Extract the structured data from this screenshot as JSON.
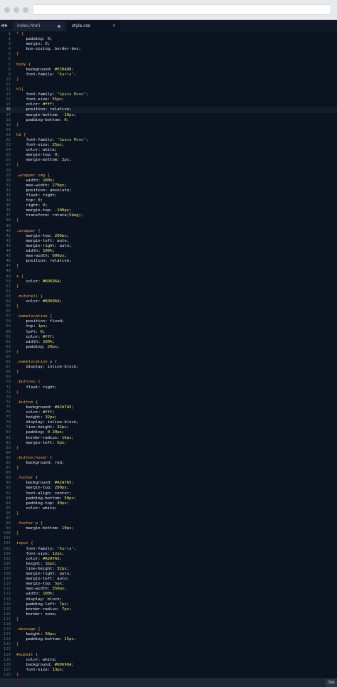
{
  "tabs": [
    {
      "label": "index.html",
      "active": false
    },
    {
      "label": "style.css",
      "active": true
    }
  ],
  "active_line": 16,
  "status": {
    "right_label": "Tab"
  },
  "code_lines": [
    [
      [
        "sel",
        "* {"
      ]
    ],
    [
      [
        "prop",
        "    padding"
      ],
      [
        "kw",
        ": "
      ],
      [
        "val",
        "0"
      ],
      [
        "kw",
        ";"
      ]
    ],
    [
      [
        "prop",
        "    margin"
      ],
      [
        "kw",
        ": "
      ],
      [
        "val",
        "0"
      ],
      [
        "kw",
        ";"
      ]
    ],
    [
      [
        "prop",
        "    box-sizing"
      ],
      [
        "kw",
        ": border-box;"
      ]
    ],
    [
      [
        "sel",
        "}"
      ]
    ],
    [
      [
        "kw",
        ""
      ]
    ],
    [
      [
        "sel",
        "body {"
      ]
    ],
    [
      [
        "prop",
        "    background"
      ],
      [
        "kw",
        ": "
      ],
      [
        "val",
        "#E2DAD8"
      ],
      [
        "kw",
        ";"
      ]
    ],
    [
      [
        "prop",
        "    font-family"
      ],
      [
        "kw",
        ": "
      ],
      [
        "str",
        "\"Karla\""
      ],
      [
        "kw",
        ";"
      ]
    ],
    [
      [
        "sel",
        "}"
      ]
    ],
    [
      [
        "kw",
        ""
      ]
    ],
    [
      [
        "sel",
        "h1{"
      ]
    ],
    [
      [
        "prop",
        "    font-family"
      ],
      [
        "kw",
        ": "
      ],
      [
        "str",
        "\"Space Mono\""
      ],
      [
        "kw",
        ";"
      ]
    ],
    [
      [
        "prop",
        "    font-size"
      ],
      [
        "kw",
        ": "
      ],
      [
        "val",
        "55px"
      ],
      [
        "kw",
        ";"
      ]
    ],
    [
      [
        "prop",
        "    color"
      ],
      [
        "kw",
        ": "
      ],
      [
        "val",
        "#fff"
      ],
      [
        "kw",
        ";"
      ]
    ],
    [
      [
        "prop",
        "    position"
      ],
      [
        "kw",
        ": relative;"
      ]
    ],
    [
      [
        "prop",
        "    margin-bottom"
      ],
      [
        "kw",
        ": "
      ],
      [
        "val",
        "-10px"
      ],
      [
        "kw",
        ";"
      ]
    ],
    [
      [
        "prop",
        "    padding-bottom"
      ],
      [
        "kw",
        ": "
      ],
      [
        "val",
        "0"
      ],
      [
        "kw",
        ";"
      ]
    ],
    [
      [
        "sel",
        "}"
      ]
    ],
    [
      [
        "kw",
        ""
      ]
    ],
    [
      [
        "sel",
        "h2 {"
      ]
    ],
    [
      [
        "prop",
        "    font-family"
      ],
      [
        "kw",
        ": "
      ],
      [
        "str",
        "\"Space Mono\""
      ],
      [
        "kw",
        ";"
      ]
    ],
    [
      [
        "prop",
        "    font-size"
      ],
      [
        "kw",
        ": "
      ],
      [
        "val",
        "25px"
      ],
      [
        "kw",
        ";"
      ]
    ],
    [
      [
        "prop",
        "    color"
      ],
      [
        "kw",
        ": white;"
      ]
    ],
    [
      [
        "prop",
        "    margin-top"
      ],
      [
        "kw",
        ": "
      ],
      [
        "val",
        "0"
      ],
      [
        "kw",
        ";"
      ]
    ],
    [
      [
        "prop",
        "    margin-bottom"
      ],
      [
        "kw",
        ": "
      ],
      [
        "val",
        "2px"
      ],
      [
        "kw",
        ";"
      ]
    ],
    [
      [
        "sel",
        "}"
      ]
    ],
    [
      [
        "kw",
        ""
      ]
    ],
    [
      [
        "sel",
        ".wrapper img {"
      ]
    ],
    [
      [
        "prop",
        "    width"
      ],
      [
        "kw",
        ": "
      ],
      [
        "val",
        "100%"
      ],
      [
        "kw",
        ";"
      ]
    ],
    [
      [
        "prop",
        "    max-width"
      ],
      [
        "kw",
        ": "
      ],
      [
        "val",
        "270px"
      ],
      [
        "kw",
        ";"
      ]
    ],
    [
      [
        "prop",
        "    position"
      ],
      [
        "kw",
        ": absolute;"
      ]
    ],
    [
      [
        "prop",
        "    float"
      ],
      [
        "kw",
        ": right;"
      ]
    ],
    [
      [
        "prop",
        "    top"
      ],
      [
        "kw",
        ": "
      ],
      [
        "val",
        "0"
      ],
      [
        "kw",
        ";"
      ]
    ],
    [
      [
        "prop",
        "    right"
      ],
      [
        "kw",
        ": "
      ],
      [
        "val",
        "0"
      ],
      [
        "kw",
        ";"
      ]
    ],
    [
      [
        "prop",
        "    margin-top"
      ],
      [
        "kw",
        ": "
      ],
      [
        "val",
        "-100px"
      ],
      [
        "kw",
        ";"
      ]
    ],
    [
      [
        "prop",
        "    transform"
      ],
      [
        "kw",
        ": rotate("
      ],
      [
        "val",
        "5deg"
      ],
      [
        "kw",
        ");"
      ]
    ],
    [
      [
        "sel",
        "}"
      ]
    ],
    [
      [
        "kw",
        ""
      ]
    ],
    [
      [
        "sel",
        ".wrapper {"
      ]
    ],
    [
      [
        "prop",
        "    margin-top"
      ],
      [
        "kw",
        ": "
      ],
      [
        "val",
        "200px"
      ],
      [
        "kw",
        ";"
      ]
    ],
    [
      [
        "prop",
        "    margin-left"
      ],
      [
        "kw",
        ": auto;"
      ]
    ],
    [
      [
        "prop",
        "    margin-right"
      ],
      [
        "kw",
        ": auto;"
      ]
    ],
    [
      [
        "prop",
        "    width"
      ],
      [
        "kw",
        ": "
      ],
      [
        "val",
        "100%"
      ],
      [
        "kw",
        ";"
      ]
    ],
    [
      [
        "prop",
        "    max-width"
      ],
      [
        "kw",
        ": "
      ],
      [
        "val",
        "600px"
      ],
      [
        "kw",
        ";"
      ]
    ],
    [
      [
        "prop",
        "    position"
      ],
      [
        "kw",
        ": relative;"
      ]
    ],
    [
      [
        "sel",
        "}"
      ]
    ],
    [
      [
        "kw",
        ""
      ]
    ],
    [
      [
        "sel",
        "a {"
      ]
    ],
    [
      [
        "prop",
        "    color"
      ],
      [
        "kw",
        ": "
      ],
      [
        "val",
        "#6D696A"
      ],
      [
        "kw",
        ";"
      ]
    ],
    [
      [
        "sel",
        "}"
      ]
    ],
    [
      [
        "kw",
        ""
      ]
    ],
    [
      [
        "sel",
        ".nutshell {"
      ]
    ],
    [
      [
        "prop",
        "    color"
      ],
      [
        "kw",
        ": "
      ],
      [
        "val",
        "#6D696A"
      ],
      [
        "kw",
        ";"
      ]
    ],
    [
      [
        "sel",
        "}"
      ]
    ],
    [
      [
        "kw",
        ""
      ]
    ],
    [
      [
        "sel",
        ".namelocation {"
      ]
    ],
    [
      [
        "prop",
        "    position"
      ],
      [
        "kw",
        ": fixed;"
      ]
    ],
    [
      [
        "prop",
        "    top"
      ],
      [
        "kw",
        ": "
      ],
      [
        "val",
        "1px"
      ],
      [
        "kw",
        ";"
      ]
    ],
    [
      [
        "prop",
        "    left"
      ],
      [
        "kw",
        ": "
      ],
      [
        "val",
        "0"
      ],
      [
        "kw",
        ";"
      ]
    ],
    [
      [
        "prop",
        "    color"
      ],
      [
        "kw",
        ": "
      ],
      [
        "val",
        "#fff"
      ],
      [
        "kw",
        ";"
      ]
    ],
    [
      [
        "prop",
        "    width"
      ],
      [
        "kw",
        ": "
      ],
      [
        "val",
        "100%"
      ],
      [
        "kw",
        ";"
      ]
    ],
    [
      [
        "prop",
        "    padding"
      ],
      [
        "kw",
        ": "
      ],
      [
        "val",
        "20px"
      ],
      [
        "kw",
        ";"
      ]
    ],
    [
      [
        "sel",
        "}"
      ]
    ],
    [
      [
        "kw",
        ""
      ]
    ],
    [
      [
        "sel",
        ".namelocation p {"
      ]
    ],
    [
      [
        "prop",
        "    display"
      ],
      [
        "kw",
        ": inline-block;"
      ]
    ],
    [
      [
        "sel",
        "}"
      ]
    ],
    [
      [
        "kw",
        ""
      ]
    ],
    [
      [
        "sel",
        ".buttons {"
      ]
    ],
    [
      [
        "prop",
        "    float"
      ],
      [
        "kw",
        ": right;"
      ]
    ],
    [
      [
        "sel",
        "}"
      ]
    ],
    [
      [
        "kw",
        ""
      ]
    ],
    [
      [
        "sel",
        ".button {"
      ]
    ],
    [
      [
        "prop",
        "    background"
      ],
      [
        "kw",
        ": "
      ],
      [
        "val",
        "#A2A7A5"
      ],
      [
        "kw",
        ";"
      ]
    ],
    [
      [
        "prop",
        "    color"
      ],
      [
        "kw",
        ": "
      ],
      [
        "val",
        "#fff"
      ],
      [
        "kw",
        ";"
      ]
    ],
    [
      [
        "prop",
        "    height"
      ],
      [
        "kw",
        ": "
      ],
      [
        "val",
        "32px"
      ],
      [
        "kw",
        ";"
      ]
    ],
    [
      [
        "prop",
        "    display"
      ],
      [
        "kw",
        ": inline-block;"
      ]
    ],
    [
      [
        "prop",
        "    line-height"
      ],
      [
        "kw",
        ": "
      ],
      [
        "val",
        "32px"
      ],
      [
        "kw",
        ";"
      ]
    ],
    [
      [
        "prop",
        "    padding"
      ],
      [
        "kw",
        ": "
      ],
      [
        "val",
        "0 20px"
      ],
      [
        "kw",
        ";"
      ]
    ],
    [
      [
        "prop",
        "    border-radius"
      ],
      [
        "kw",
        ": "
      ],
      [
        "val",
        "16px"
      ],
      [
        "kw",
        ";"
      ]
    ],
    [
      [
        "prop",
        "    margin-left"
      ],
      [
        "kw",
        ": "
      ],
      [
        "val",
        "5px"
      ],
      [
        "kw",
        ";"
      ]
    ],
    [
      [
        "sel",
        "}"
      ]
    ],
    [
      [
        "kw",
        ""
      ]
    ],
    [
      [
        "sel",
        ".button:hover {"
      ]
    ],
    [
      [
        "prop",
        "    background"
      ],
      [
        "kw",
        ": red;"
      ]
    ],
    [
      [
        "sel",
        "}"
      ]
    ],
    [
      [
        "kw",
        ""
      ]
    ],
    [
      [
        "sel",
        ".footer {"
      ]
    ],
    [
      [
        "prop",
        "    background"
      ],
      [
        "kw",
        ": "
      ],
      [
        "val",
        "#A2A7A5"
      ],
      [
        "kw",
        ";"
      ]
    ],
    [
      [
        "prop",
        "    margin-top"
      ],
      [
        "kw",
        ": "
      ],
      [
        "val",
        "200px"
      ],
      [
        "kw",
        ";"
      ]
    ],
    [
      [
        "prop",
        "    text-align"
      ],
      [
        "kw",
        ": center;"
      ]
    ],
    [
      [
        "prop",
        "    padding-bottom"
      ],
      [
        "kw",
        ": "
      ],
      [
        "val",
        "50px"
      ],
      [
        "kw",
        ";"
      ]
    ],
    [
      [
        "prop",
        "    padding-top"
      ],
      [
        "kw",
        ": "
      ],
      [
        "val",
        "30px"
      ],
      [
        "kw",
        ";"
      ]
    ],
    [
      [
        "prop",
        "    color"
      ],
      [
        "kw",
        ": white;"
      ]
    ],
    [
      [
        "sel",
        "}"
      ]
    ],
    [
      [
        "kw",
        ""
      ]
    ],
    [
      [
        "sel",
        ".footer p {"
      ]
    ],
    [
      [
        "prop",
        "    margin-bottom"
      ],
      [
        "kw",
        ": "
      ],
      [
        "val",
        "10px"
      ],
      [
        "kw",
        ";"
      ]
    ],
    [
      [
        "sel",
        "}"
      ]
    ],
    [
      [
        "kw",
        ""
      ]
    ],
    [
      [
        "sel",
        "input {"
      ]
    ],
    [
      [
        "prop",
        "    font-family"
      ],
      [
        "kw",
        ": "
      ],
      [
        "str",
        "\"Karla\""
      ],
      [
        "kw",
        ";"
      ]
    ],
    [
      [
        "prop",
        "    font-size"
      ],
      [
        "kw",
        ": "
      ],
      [
        "val",
        "12px"
      ],
      [
        "kw",
        ";"
      ]
    ],
    [
      [
        "prop",
        "    color"
      ],
      [
        "kw",
        ": "
      ],
      [
        "val",
        "#A2A7A5"
      ],
      [
        "kw",
        ";"
      ]
    ],
    [
      [
        "prop",
        "    height"
      ],
      [
        "kw",
        ": "
      ],
      [
        "val",
        "32px"
      ],
      [
        "kw",
        ";"
      ]
    ],
    [
      [
        "prop",
        "    line-height"
      ],
      [
        "kw",
        ": "
      ],
      [
        "val",
        "32px"
      ],
      [
        "kw",
        ";"
      ]
    ],
    [
      [
        "prop",
        "    margin-right"
      ],
      [
        "kw",
        ": auto;"
      ]
    ],
    [
      [
        "prop",
        "    margin-left"
      ],
      [
        "kw",
        ": auto;"
      ]
    ],
    [
      [
        "prop",
        "    margin-top"
      ],
      [
        "kw",
        ": "
      ],
      [
        "val",
        "5px"
      ],
      [
        "kw",
        ";"
      ]
    ],
    [
      [
        "prop",
        "    max-width"
      ],
      [
        "kw",
        ": "
      ],
      [
        "val",
        "350px"
      ],
      [
        "kw",
        ";"
      ]
    ],
    [
      [
        "prop",
        "    width"
      ],
      [
        "kw",
        ": "
      ],
      [
        "val",
        "100%"
      ],
      [
        "kw",
        ";"
      ]
    ],
    [
      [
        "prop",
        "    display"
      ],
      [
        "kw",
        ": block;"
      ]
    ],
    [
      [
        "prop",
        "    padding-left"
      ],
      [
        "kw",
        ": "
      ],
      [
        "val",
        "7px"
      ],
      [
        "kw",
        ";"
      ]
    ],
    [
      [
        "prop",
        "    border-radius"
      ],
      [
        "kw",
        ": "
      ],
      [
        "val",
        "7px"
      ],
      [
        "kw",
        ";"
      ]
    ],
    [
      [
        "prop",
        "    border"
      ],
      [
        "kw",
        ": none;"
      ]
    ],
    [
      [
        "sel",
        "}"
      ]
    ],
    [
      [
        "kw",
        ""
      ]
    ],
    [
      [
        "sel",
        ".message {"
      ]
    ],
    [
      [
        "prop",
        "    height"
      ],
      [
        "kw",
        ": "
      ],
      [
        "val",
        "50px"
      ],
      [
        "kw",
        ";"
      ]
    ],
    [
      [
        "prop",
        "    padding-bottom"
      ],
      [
        "kw",
        ": "
      ],
      [
        "val",
        "15px"
      ],
      [
        "kw",
        ";"
      ]
    ],
    [
      [
        "sel",
        "}"
      ]
    ],
    [
      [
        "kw",
        ""
      ]
    ],
    [
      [
        "sel",
        "#submit {"
      ]
    ],
    [
      [
        "prop",
        "    color"
      ],
      [
        "kw",
        ": white;"
      ]
    ],
    [
      [
        "prop",
        "    background"
      ],
      [
        "kw",
        ": "
      ],
      [
        "val",
        "#6D696A"
      ],
      [
        "kw",
        ";"
      ]
    ],
    [
      [
        "prop",
        "    font-size"
      ],
      [
        "kw",
        ": "
      ],
      [
        "val",
        "13px"
      ],
      [
        "kw",
        ";"
      ]
    ],
    [
      [
        "sel",
        "}"
      ]
    ]
  ]
}
